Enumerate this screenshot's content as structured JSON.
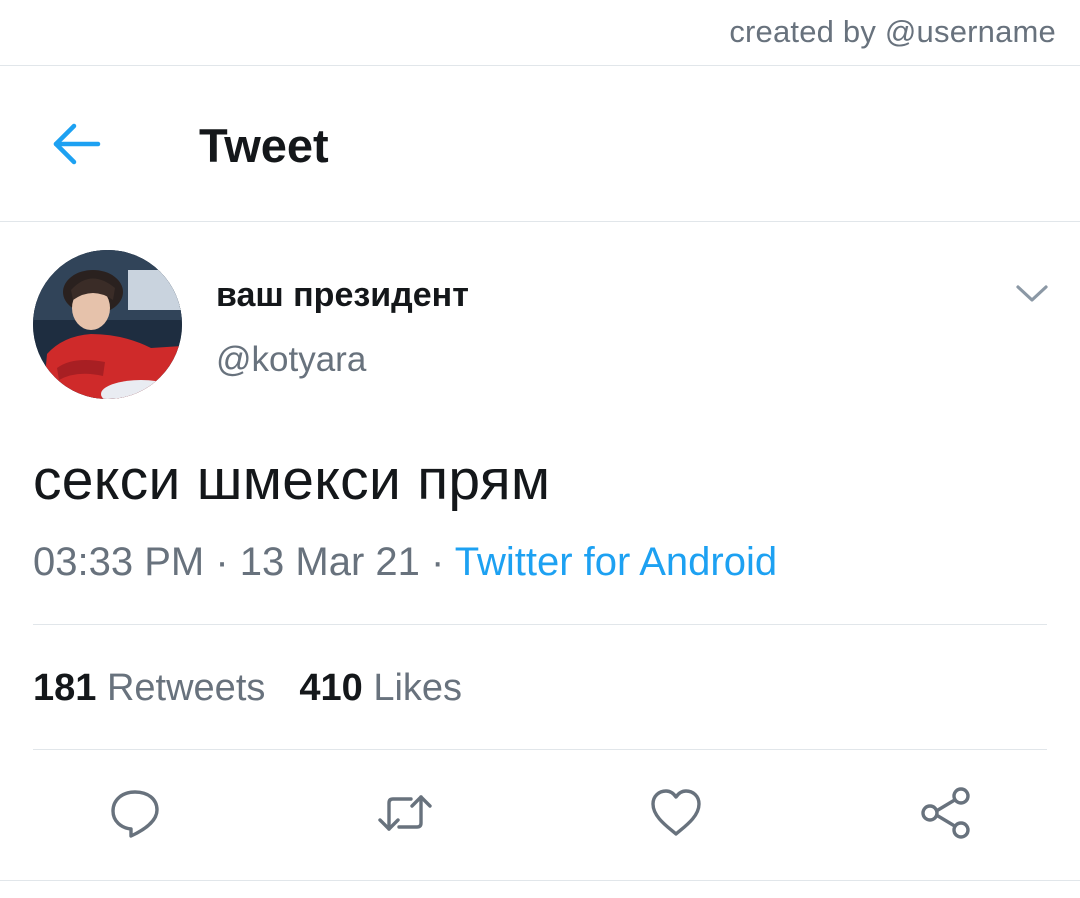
{
  "credit": {
    "text": "created by @username"
  },
  "header": {
    "title": "Tweet",
    "back_icon": "arrow-left-icon"
  },
  "author": {
    "display_name": "ваш президент",
    "handle": "@kotyara",
    "avatar": "profile-photo-avatar",
    "menu_icon": "chevron-down-icon"
  },
  "tweet": {
    "text": "секси шмекси прям",
    "time": "03:33 PM",
    "separator": "·",
    "date": "13 Mar 21",
    "source": "Twitter for Android"
  },
  "stats": {
    "retweets_count": "181",
    "retweets_label": "Retweets",
    "likes_count": "410",
    "likes_label": "Likes"
  },
  "actions": {
    "reply_icon": "reply-icon",
    "retweet_icon": "retweet-icon",
    "like_icon": "heart-icon",
    "share_icon": "share-icon"
  },
  "colors": {
    "accent": "#1da1f2",
    "text": "#14171a",
    "secondary": "#68727d",
    "divider": "#e1e6ea"
  }
}
